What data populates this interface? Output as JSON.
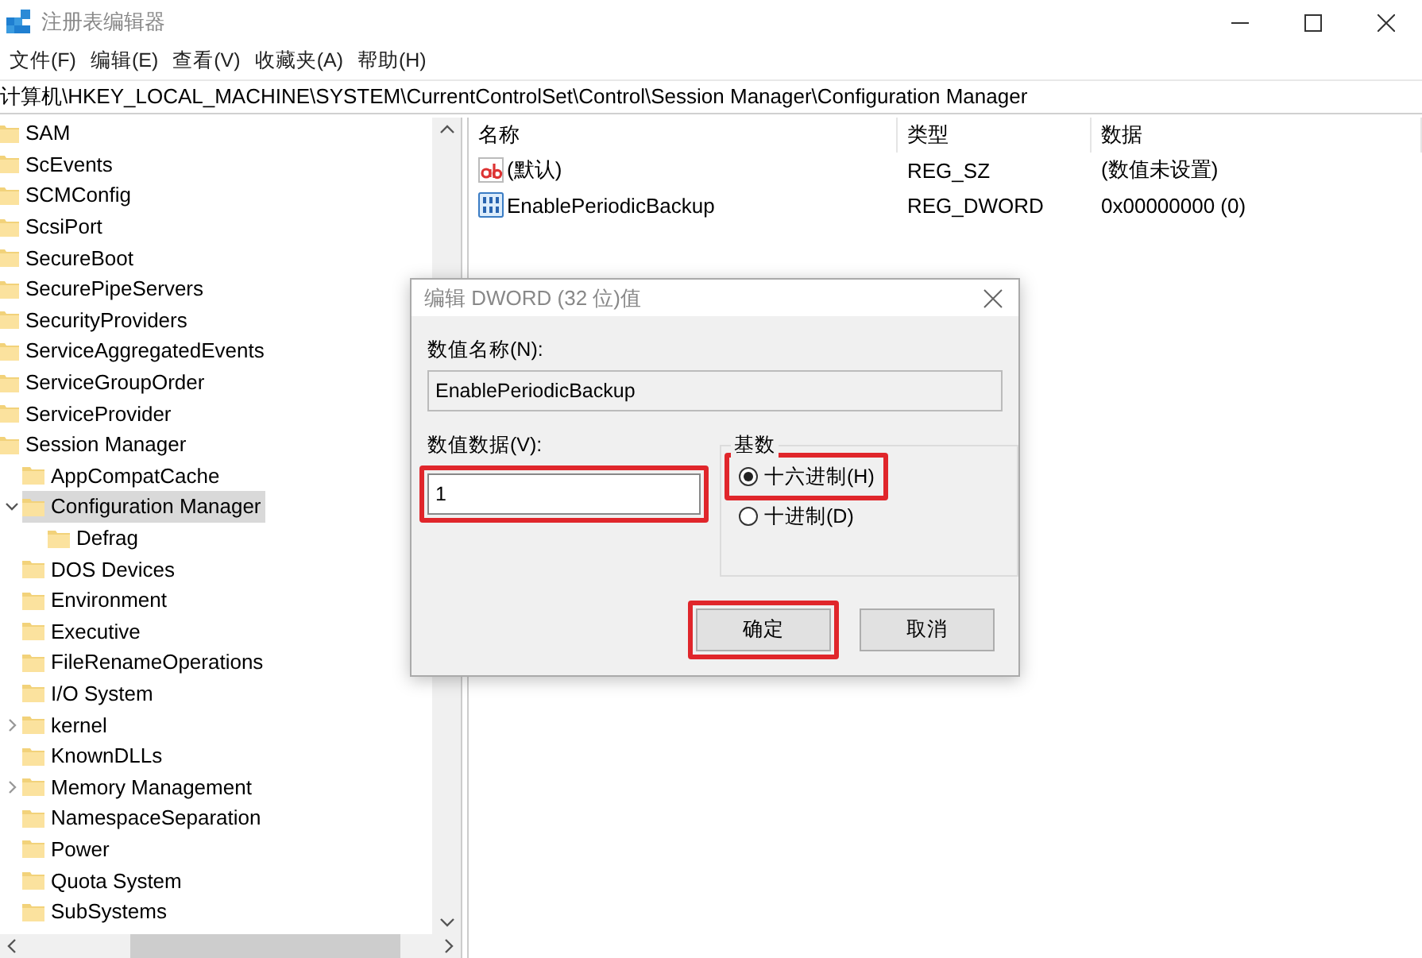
{
  "window": {
    "title": "注册表编辑器"
  },
  "menu": [
    "文件(F)",
    "编辑(E)",
    "查看(V)",
    "收藏夹(A)",
    "帮助(H)"
  ],
  "address": "计算机\\HKEY_LOCAL_MACHINE\\SYSTEM\\CurrentControlSet\\Control\\Session Manager\\Configuration Manager",
  "tree": [
    {
      "name": "SAM",
      "selected": false
    },
    {
      "name": "ScEvents",
      "selected": false
    },
    {
      "name": "SCMConfig",
      "selected": false
    },
    {
      "name": "ScsiPort",
      "selected": false
    },
    {
      "name": "SecureBoot",
      "selected": false
    },
    {
      "name": "SecurePipeServers",
      "selected": false
    },
    {
      "name": "SecurityProviders",
      "selected": false
    },
    {
      "name": "ServiceAggregatedEvents",
      "selected": false
    },
    {
      "name": "ServiceGroupOrder",
      "selected": false
    },
    {
      "name": "ServiceProvider",
      "selected": false
    },
    {
      "name": "Session Manager",
      "selected": false,
      "children": [
        {
          "name": "AppCompatCache",
          "selected": false
        },
        {
          "name": "Configuration Manager",
          "selected": true,
          "expanded": true,
          "children": [
            {
              "name": "Defrag",
              "selected": false
            }
          ]
        },
        {
          "name": "DOS Devices",
          "selected": false
        },
        {
          "name": "Environment",
          "selected": false
        },
        {
          "name": "Executive",
          "selected": false
        },
        {
          "name": "FileRenameOperations",
          "selected": false
        },
        {
          "name": "I/O System",
          "selected": false
        },
        {
          "name": "kernel",
          "selected": false,
          "expanded": false
        },
        {
          "name": "KnownDLLs",
          "selected": false
        },
        {
          "name": "Memory Management",
          "selected": false,
          "expanded": false
        },
        {
          "name": "NamespaceSeparation",
          "selected": false
        },
        {
          "name": "Power",
          "selected": false
        },
        {
          "name": "Quota System",
          "selected": false
        },
        {
          "name": "SubSystems",
          "selected": false
        }
      ]
    }
  ],
  "values": {
    "columns": [
      "名称",
      "类型",
      "数据"
    ],
    "rows": [
      {
        "kind": "string",
        "name": "(默认)",
        "type": "REG_SZ",
        "data": "(数值未设置)"
      },
      {
        "kind": "dword",
        "name": "EnablePeriodicBackup",
        "type": "REG_DWORD",
        "data": "0x00000000 (0)"
      }
    ]
  },
  "dialog": {
    "title": "编辑 DWORD (32 位)值",
    "name_label": "数值名称(N):",
    "name_value": "EnablePeriodicBackup",
    "data_label": "数值数据(V):",
    "data_value": "1",
    "data_highlighted": true,
    "radix_label": "基数",
    "radix_options": [
      {
        "label": "十六进制(H)",
        "selected": true,
        "highlighted": true
      },
      {
        "label": "十进制(D)",
        "selected": false,
        "highlighted": false
      }
    ],
    "buttons": [
      {
        "label": "确定",
        "highlighted": true
      },
      {
        "label": "取消",
        "highlighted": false
      }
    ]
  }
}
